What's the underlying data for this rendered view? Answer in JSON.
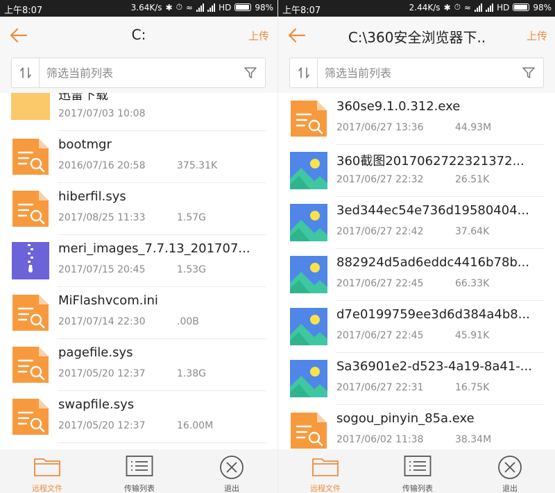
{
  "colors": {
    "accent": "#f08a3c",
    "doc_icon": "#f79a3e",
    "zip_icon": "#6c63d9",
    "image_icon": "#4f86e8",
    "folder_icon": "#fbc96a"
  },
  "statusbar": {
    "left": {
      "time": "上午8:07",
      "speed": "3.64K/s",
      "network": "HD",
      "battery": "98%"
    },
    "right": {
      "time": "上午8:07",
      "speed": "2.44K/s",
      "network": "HD",
      "battery": "98%"
    }
  },
  "left_panel": {
    "title": "C:",
    "upload_label": "上传",
    "filter_placeholder": "筛选当前列表",
    "files": [
      {
        "name": "迅雷下载",
        "date": "2017/07/03 10:08",
        "size": "",
        "icon": "folder-icon"
      },
      {
        "name": "bootmgr",
        "date": "2016/07/16 20:58",
        "size": "375.31K",
        "icon": "document-icon"
      },
      {
        "name": "hiberfil.sys",
        "date": "2017/08/25 11:33",
        "size": "1.57G",
        "icon": "document-icon"
      },
      {
        "name": " meri_images_7.7.13_201707...",
        "date": "2017/07/15 20:45",
        "size": "1.53G",
        "icon": "zip-icon"
      },
      {
        "name": "MiFlashvcom.ini",
        "date": "2017/07/14 22:30",
        "size": ".00B",
        "icon": "document-icon"
      },
      {
        "name": "pagefile.sys",
        "date": "2017/05/20 12:37",
        "size": "1.38G",
        "icon": "document-icon"
      },
      {
        "name": "swapfile.sys",
        "date": "2017/05/20 12:37",
        "size": "16.00M",
        "icon": "document-icon"
      }
    ]
  },
  "right_panel": {
    "title": "C:\\360安全浏览器下..",
    "upload_label": "上传",
    "filter_placeholder": "筛选当前列表",
    "files": [
      {
        "name": "360se9.1.0.312.exe",
        "date": "2017/06/27 13:36",
        "size": "44.93M",
        "icon": "document-icon"
      },
      {
        "name": " 360截图2017062722321372...",
        "date": "2017/06/27 22:32",
        "size": "26.51K",
        "icon": "image-icon"
      },
      {
        "name": " 3ed344ec54e736d19580404...",
        "date": "2017/06/27 22:42",
        "size": "37.64K",
        "icon": "image-icon"
      },
      {
        "name": "882924d5ad6eddc4416b78b...",
        "date": "2017/06/27 22:45",
        "size": "66.33K",
        "icon": "image-icon"
      },
      {
        "name": "d7e0199759ee3d6d384a4b8...",
        "date": "2017/06/27 22:45",
        "size": "45.91K",
        "icon": "image-icon"
      },
      {
        "name": "Sa36901e2-d523-4a19-8a41-...",
        "date": "2017/06/27 22:31",
        "size": "16.75K",
        "icon": "image-icon"
      },
      {
        "name": "sogou_pinyin_85a.exe",
        "date": "2017/06/02 11:38",
        "size": "38.34M",
        "icon": "document-icon"
      }
    ]
  },
  "bottom_nav": {
    "remote_files": "远程文件",
    "transfer_list": "传输列表",
    "exit": "退出"
  }
}
